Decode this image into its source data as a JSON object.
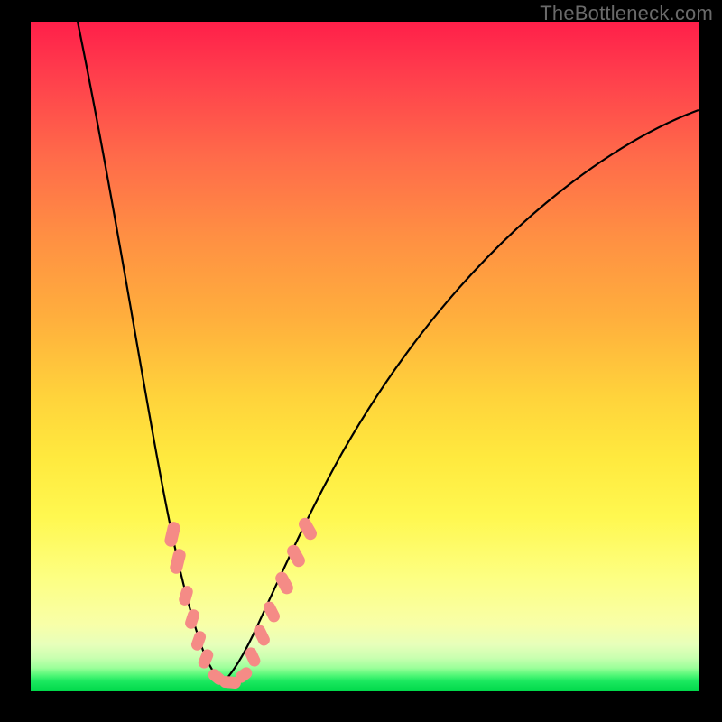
{
  "watermark": "TheBottleneck.com",
  "colors": {
    "background": "#000000",
    "curve": "#000000",
    "beads": "#f58b86",
    "gradient_stops": [
      "#ff1f4a",
      "#ff3e4c",
      "#ff6a4a",
      "#ff8f43",
      "#ffae3d",
      "#ffd33b",
      "#ffe93e",
      "#fff850",
      "#fdff82",
      "#f8ffa8",
      "#e7ffba",
      "#c9ffb0",
      "#9cff9a",
      "#58f87a",
      "#1be85f",
      "#00d84a"
    ]
  },
  "chart_data": {
    "type": "line",
    "title": "",
    "xlabel": "",
    "ylabel": "",
    "xlim": [
      0,
      100
    ],
    "ylim": [
      0,
      100
    ],
    "note": "No numeric axes or tick labels are rendered in the image; values below are read off pixel positions normalised to 0–100 on each axis. Minimum of the V sits near x≈29, y≈1.",
    "series": [
      {
        "name": "curve-left-branch",
        "x": [
          7.0,
          12.8,
          17.6,
          20.9,
          24.3,
          25.7,
          28.8
        ],
        "y": [
          100.0,
          71.7,
          40.7,
          24.5,
          6.5,
          2.7,
          1.3
        ]
      },
      {
        "name": "curve-right-branch",
        "x": [
          28.8,
          33.8,
          41.4,
          46.6,
          54.1,
          62.2,
          73.0,
          82.4,
          91.9,
          100.0
        ],
        "y": [
          1.3,
          9.4,
          26.1,
          35.6,
          47.6,
          59.0,
          69.3,
          77.9,
          83.8,
          86.8
        ]
      }
    ],
    "highlighted_points": {
      "name": "salmon-beads-on-curve",
      "x": [
        21.2,
        22.0,
        23.2,
        24.2,
        25.1,
        26.2,
        27.8,
        29.9,
        31.9,
        33.2,
        34.6,
        36.1,
        38.0,
        39.7,
        41.5
      ],
      "y": [
        23.5,
        19.4,
        14.3,
        10.8,
        7.5,
        4.9,
        2.2,
        1.3,
        2.4,
        5.1,
        8.4,
        11.9,
        16.2,
        20.2,
        24.3
      ]
    }
  }
}
